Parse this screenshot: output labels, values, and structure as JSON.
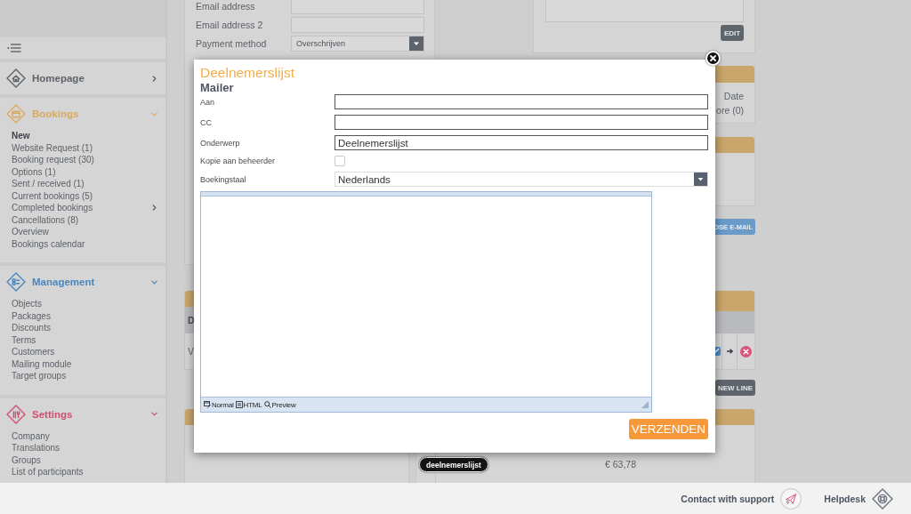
{
  "sidebar": {
    "sections": [
      {
        "title": "Homepage",
        "kind": "home",
        "color": "#5e636a",
        "expanded": false
      },
      {
        "title": "Bookings",
        "kind": "bookings",
        "color": "#d9a95e",
        "expanded": true,
        "items": [
          {
            "label": "New",
            "selected": true,
            "expandable": false
          },
          {
            "label": "Website Request (1)",
            "selected": false,
            "expandable": false
          },
          {
            "label": "Booking request (30)",
            "selected": false,
            "expandable": false
          },
          {
            "label": "Options (1)",
            "selected": false,
            "expandable": false
          },
          {
            "label": "Sent / received (1)",
            "selected": false,
            "expandable": false
          },
          {
            "label": "Current bookings (5)",
            "selected": false,
            "expandable": false
          },
          {
            "label": "Completed bookings",
            "selected": false,
            "expandable": true
          },
          {
            "label": "Cancellations (8)",
            "selected": false,
            "expandable": false
          },
          {
            "label": "Overview",
            "selected": false,
            "expandable": false
          },
          {
            "label": "Bookings calendar",
            "selected": false,
            "expandable": false
          }
        ]
      },
      {
        "title": "Management",
        "kind": "management",
        "color": "#4a86bd",
        "expanded": true,
        "items": [
          {
            "label": "Objects",
            "selected": false,
            "expandable": false
          },
          {
            "label": "Packages",
            "selected": false,
            "expandable": false
          },
          {
            "label": "Discounts",
            "selected": false,
            "expandable": false
          },
          {
            "label": "Terms",
            "selected": false,
            "expandable": false
          },
          {
            "label": "Customers",
            "selected": false,
            "expandable": false
          },
          {
            "label": "Mailing module",
            "selected": false,
            "expandable": false
          },
          {
            "label": "Target groups",
            "selected": false,
            "expandable": false
          }
        ]
      },
      {
        "title": "Settings",
        "kind": "settings",
        "color": "#d04d72",
        "expanded": true,
        "items": [
          {
            "label": "Company",
            "selected": false,
            "expandable": false
          },
          {
            "label": "Translations",
            "selected": false,
            "expandable": false
          },
          {
            "label": "Groups",
            "selected": false,
            "expandable": false
          },
          {
            "label": "List of participants",
            "selected": false,
            "expandable": false
          }
        ]
      }
    ]
  },
  "customer_form": {
    "fields": [
      {
        "label": "Email address",
        "kind": "text"
      },
      {
        "label": "Email address 2",
        "kind": "text"
      },
      {
        "label": "Payment method",
        "kind": "select",
        "value": "Overschrijven"
      }
    ]
  },
  "notes_panel": {
    "button": "EDIT"
  },
  "summary_panel": {
    "heading": "Date",
    "value": "ore (0)"
  },
  "email_button": "OSE E-MAIL",
  "left_table": {
    "header_cell": "D",
    "row_cell": "V"
  },
  "new_line_button": "NEW LINE",
  "price_panel": {
    "amount": "€ 63,78",
    "tooltip": "deelnemerslijst"
  },
  "mailer_dialog": {
    "title": "Deelnemerslijst",
    "subtitle": "Mailer",
    "fields": [
      {
        "label": "Aan",
        "kind": "text"
      },
      {
        "label": "CC",
        "kind": "text"
      },
      {
        "label": "Onderwerp",
        "kind": "text",
        "value": "Deelnemerslijst"
      },
      {
        "label": "Kopie aan beheerder",
        "kind": "checkbox",
        "checked": false
      },
      {
        "label": "Boekingstaal",
        "kind": "select",
        "value": "Nederlands"
      }
    ],
    "editor": {
      "modes": [
        {
          "label": "Normal",
          "kind": "normal"
        },
        {
          "label": "HTML",
          "kind": "html"
        },
        {
          "label": "Preview",
          "kind": "preview"
        }
      ]
    },
    "submit": "VERZENDEN"
  },
  "footer": {
    "links": [
      {
        "label": "Contact with support",
        "kind": "support"
      },
      {
        "label": "Helpdesk",
        "kind": "helpdesk"
      }
    ]
  }
}
